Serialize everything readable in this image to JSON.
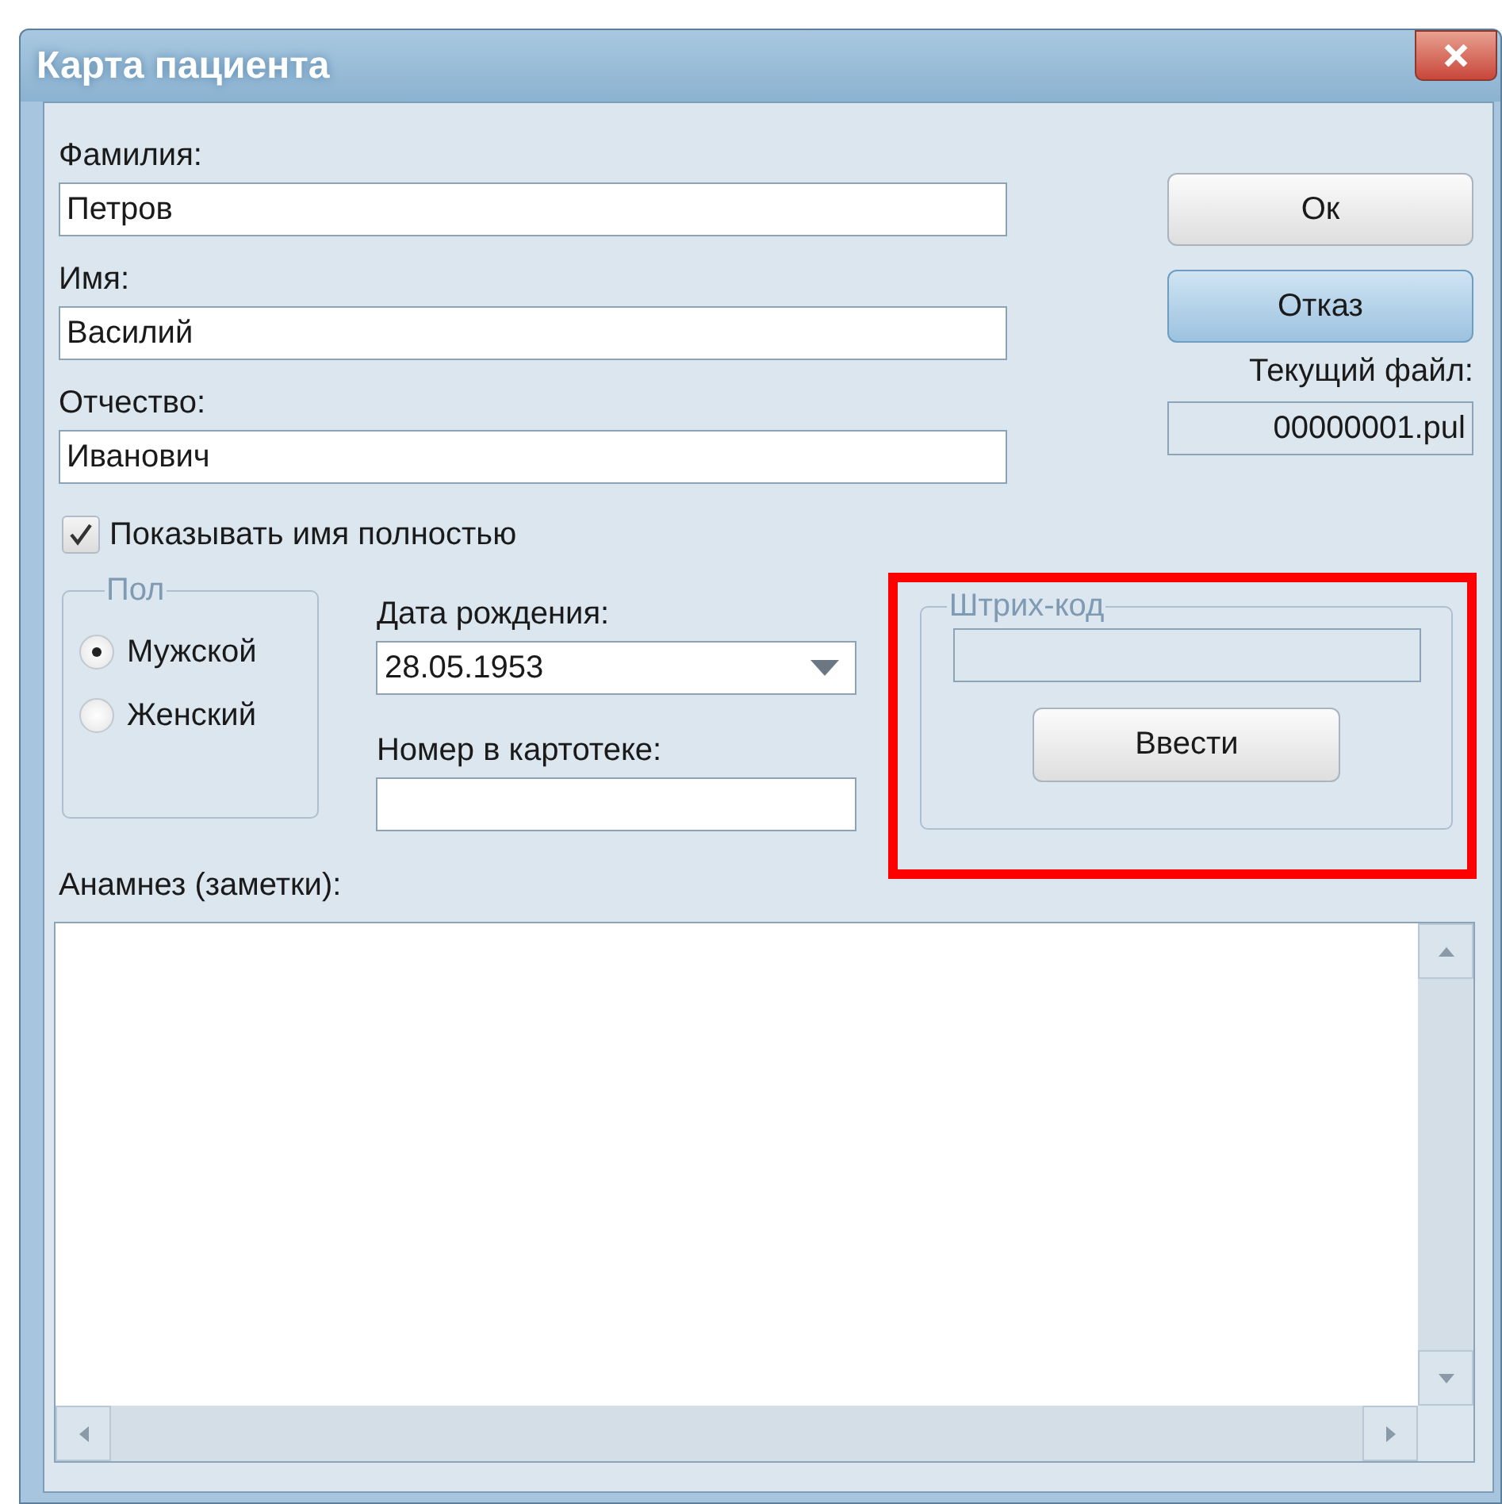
{
  "window": {
    "title": "Карта пациента"
  },
  "fields": [
    {
      "label": "Фамилия:",
      "value": "Петров"
    },
    {
      "label": "Имя:",
      "value": "Василий"
    },
    {
      "label": "Отчество:",
      "value": "Иванович"
    }
  ],
  "buttons": [
    {
      "label": "Ок",
      "selected": false
    },
    {
      "label": "Отказ",
      "selected": true
    }
  ],
  "current_file": {
    "label": "Текущий файл:",
    "value": "00000001.pul"
  },
  "show_full_name": {
    "label": "Показывать имя полностью",
    "checked": true
  },
  "gender": {
    "title": "Пол",
    "options": [
      {
        "label": "Мужской",
        "selected": true
      },
      {
        "label": "Женский",
        "selected": false
      }
    ]
  },
  "birth_date": {
    "label": "Дата рождения:",
    "value": "28.05.1953"
  },
  "card_number": {
    "label": "Номер в картотеке:"
  },
  "barcode": {
    "title": "Штрих-код",
    "button": "Ввести",
    "highlighted": true
  },
  "notes": {
    "label": "Анамнез (заметки):"
  }
}
